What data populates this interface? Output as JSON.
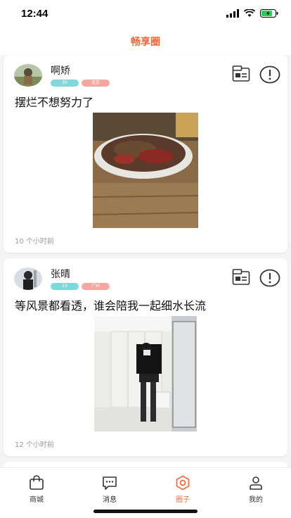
{
  "status_bar": {
    "time": "12:44"
  },
  "header": {
    "title": "畅享圈"
  },
  "posts": [
    {
      "username": "啊矫",
      "age": "30",
      "city": "北京",
      "content": "摆烂不想努力了",
      "timestamp": "10 个小时前",
      "image_description": "food plate"
    },
    {
      "username": "张晴",
      "age": "23",
      "city": "广州",
      "content": "等风景都看透，谁会陪我一起细水长流",
      "timestamp": "12 个小时前",
      "image_description": "mirror selfie"
    }
  ],
  "tabs": [
    {
      "label": "商城",
      "icon": "shopping-bag-icon",
      "active": false
    },
    {
      "label": "消息",
      "icon": "message-icon",
      "active": false
    },
    {
      "label": "圈子",
      "icon": "hexagon-circle-icon",
      "active": true
    },
    {
      "label": "我的",
      "icon": "user-icon",
      "active": false
    }
  ],
  "colors": {
    "accent": "#f1683d",
    "age_tag": "#7fd8dc",
    "city_tag": "#f4a8a0",
    "background": "#f4f4f4"
  }
}
